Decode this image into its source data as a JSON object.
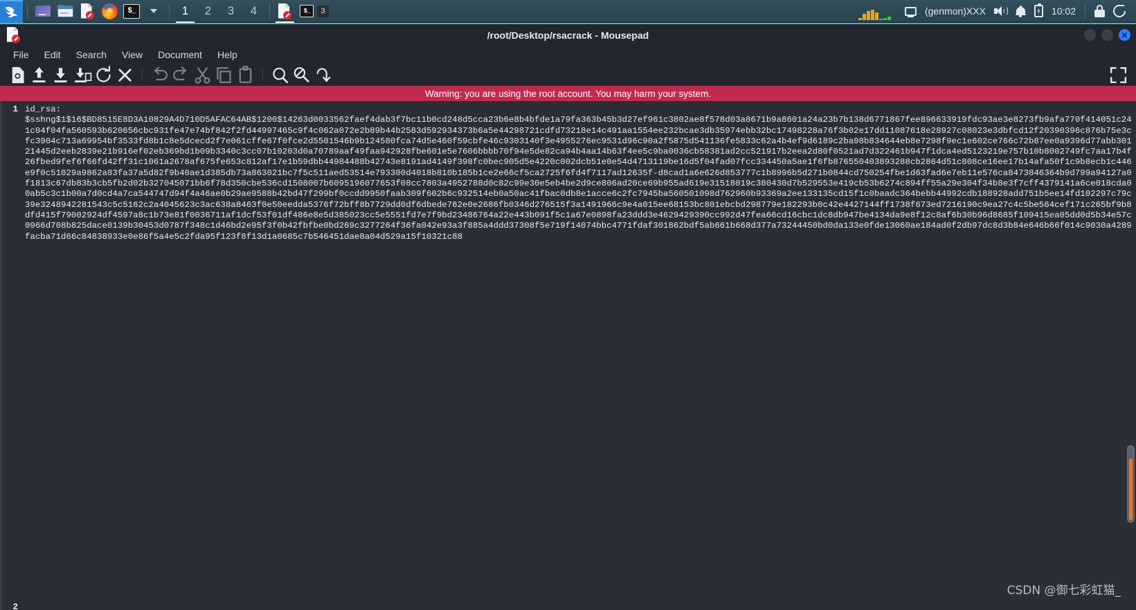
{
  "taskbar": {
    "launchers": [
      {
        "name": "kali-menu",
        "icon": "kali-dragon-icon"
      },
      {
        "name": "terminal-emulator",
        "icon": "monitor-icon"
      },
      {
        "name": "file-manager",
        "icon": "folder-icon"
      },
      {
        "name": "text-editor",
        "icon": "document-edit-icon"
      },
      {
        "name": "web-browser",
        "icon": "firefox-icon"
      },
      {
        "name": "terminal",
        "icon": "terminal-icon",
        "label": "$_"
      },
      {
        "name": "launcher-chevron",
        "icon": "chevron-down-icon"
      }
    ],
    "workspaces": [
      {
        "label": "1",
        "active": true
      },
      {
        "label": "2",
        "active": false
      },
      {
        "label": "3",
        "active": false
      },
      {
        "label": "4",
        "active": false
      }
    ],
    "windows": [
      {
        "name": "mousepad-task",
        "icon": "document-edit-icon",
        "active": true
      },
      {
        "name": "terminal-task",
        "icon": "terminal-icon",
        "badge": "3"
      }
    ],
    "tray": {
      "genmon": "(genmon)XXX",
      "clock": "10:02",
      "cpu_graph_bars": [
        18,
        55,
        80,
        92,
        70,
        14,
        16,
        30
      ],
      "cpu_graph_colors": [
        "#f0a21a",
        "#f0a21a",
        "#f0a21a",
        "#f0a21a",
        "#f0a21a",
        "#2ecc40",
        "#2ecc40",
        "#2ecc40"
      ],
      "icons": [
        "display-icon",
        "speaker-icon",
        "bell-icon",
        "battery-icon",
        "lock-icon",
        "power-icon"
      ]
    },
    "accent_color": "#2b7fd4",
    "background_color": "#2d4854"
  },
  "window": {
    "title": "/root/Desktop/rsacrack - Mousepad",
    "icon": "document-edit-icon",
    "controls": {
      "minimize": "minimize-button",
      "maximize": "maximize-button",
      "close_glyph": "✕"
    },
    "accent_border": "#3fb6c8"
  },
  "menubar": {
    "items": [
      {
        "label": "File"
      },
      {
        "label": "Edit"
      },
      {
        "label": "Search"
      },
      {
        "label": "View"
      },
      {
        "label": "Document"
      },
      {
        "label": "Help"
      }
    ]
  },
  "toolbar": {
    "groups": [
      [
        "new-file-icon",
        "open-file-icon",
        "save-file-icon",
        "save-as-icon",
        "reload-icon",
        "close-document-icon"
      ],
      [
        "undo-icon",
        "redo-icon",
        "cut-icon",
        "copy-icon",
        "paste-icon"
      ],
      [
        "find-icon",
        "find-replace-icon",
        "go-to-line-icon"
      ]
    ],
    "fullscreen": "fullscreen-icon"
  },
  "warning": {
    "text": "Warning: you are using the root account. You may harm your system."
  },
  "editor": {
    "line_numbers": [
      "1",
      "2"
    ],
    "lines": [
      "id_rsa:",
      "$sshng$1$16$BD8515E8D3A10829A4D710D5AFAC64AB$1200$14263d0033562faef4dab3f7bc11b0cd248d5cca23b6e8b4bfde1a79fa363b45b3d27ef961c3802ae8f578d03a8671b9a8601a24a23b7b138d6771867fee896633919fdc93ae3e8273fb9afa770f414051c241c04f04fa560593b620656cbc931fe47e74bf842f2fd44997465c9f4c062a072e2b89b44b2583d592934373b6a5e44298721cdfd73218e14c491aa1554ee232bcae3db35974ebb32bc17498228a76f3b02e17dd11087618e28927c08023e3dbfcd12f20390396c876b75e3cfc3904c713a69954bf3533fd8b1c8e5dcecd2f7e061cffe67f0fce2d5501546b9b124580fca74d5e460f59cbfe46c9303140f3e4955276ec9531d96c90a2f5875d541136fe5833c62a4b4ef9d6189c2ba98b834644eb8e7298f9ec1e602ce766c72b87ee0a9396d77abb30121445d2eeb2839e21b916ef02eb369bd1b09b3340c3cc07b10203d0a70789aaf49faa942928fbe601e5e7606bbbb70f94e5de82ca94b4aa14b63f4ee5c9ba0036cb58381ad2cc521917b2eea2d80f0521ad7d322461b947f1dca4ed5123219e757b10b8002749fc7aa17b4f26fbed9fef6f66fd42ff31c1061a2678af675fe653c812af17e1b59dbb44984488b42743e8191ad4149f398fc0bec905d5e4220c002dcb51e0e54d4713119be16d5f04fad07fcc334450a5ae1f6fb876550403893288cb2864d51c808ce16ee17b14afa50f1c9b8ecb1c446e9f0c51029a9862a83fa37a5d82f9b40ae1d385db73a863021bc7f5c511aed53514e793300d4018b810b185b1ce2e66cf5ca2725f6fd4f7117ad12635f-d8cad1a6e626d853777c1b8996b5d271b0844cd750254fbe1d63fad6e7eb11e576ca8473846364b9d799a94127a0f1813c67db83b3cb5fb2d02b327045071bb6f78d350cbe536cd1508007b6095196077653f08cc7803a4952788d0c82c99e30e5eb4be2d9ce806ad20ce69b955ad619e31518019c380430d7b529553e419cb53b6274c894ff55a29e304f34b8e3f7cff4379141a6ce018cda00ab5c3c1b00a7d0cd4a7ca544747d94f4a46ae0b29ae9588b42bd47f299bf0ccdd9950faab309f602b6c932514eb0a50ac41fbac0db8e1acce6c2fc7945ba560501098d762960b93369a2ee133135cd15f1c0baadc364bebb44992cdb188928add751b5ee14fd102297c79c39e3248942281543c5c5162c2a4045623c3ac638a8463f0e50eedda5376f72bff8b7729dd0df6dbede762e0e2686fb0346d276515f3a1491966c9e4a015ee68153bc801ebcbd298779e182293b0c42e4427144ff1738f673ed7216190c9ea27c4c5be564cef171c265bf9b8dfd415f79002924df4597a8c1b73e81f0036711af1dcf53f01df486e8e5d385023cc5e5551fd7e7f9bd23486764a22e443b091f5c1a67e0898fa23ddd3e4629429390cc992d47fea66cd16cbc1dc8db947be4134da9e8f12c8af6b30b96d8685f109415ea05dd0d5b34e57c0966d708b825dace0139b30453d0787f348c1d46bd2e95f3f0b42fbfbe0bd269c3277264f36fa042e93a3f885a4ddd37308f5e719f14074bbc4771fdaf301862bdf5ab661b668d377a73244450bd0da133e0fde13060ae184ad0f2db97dc8d3b84e646b66f014c9030a4289facba71d66c84838933e0e86f5a4e5c2fda95f123f8f13d1a0685c7b546451dae8a04d529a15f10321c88"
    ],
    "background": "#2b2e36",
    "text_color": "#e8ecf1"
  },
  "watermark": {
    "text": "CSDN @御七彩虹猫_"
  }
}
